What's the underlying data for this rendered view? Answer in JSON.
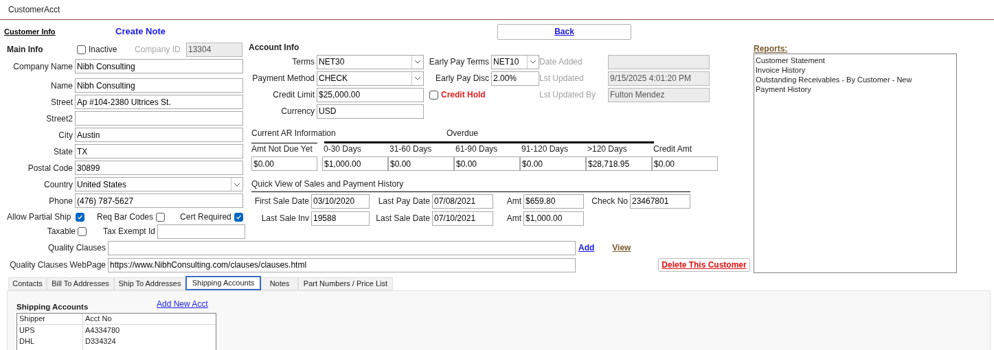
{
  "window": {
    "title": "CustomerAcct"
  },
  "header": {
    "customer_info_link": "Customer Info",
    "create_note_link": "Create Note",
    "back_button": "Back"
  },
  "main_info": {
    "title": "Main Info",
    "inactive": {
      "label": "Inactive",
      "checked": false
    },
    "company_id": {
      "label": "Company ID",
      "value": "13304"
    },
    "fields": [
      {
        "kind": "text",
        "label": "Company Name",
        "value": "Nibh Consulting"
      },
      {
        "kind": "text",
        "label": "Name",
        "value": "Nibh Consulting"
      },
      {
        "kind": "text",
        "label": "Street",
        "value": "Ap #104-2380 Ultrices St."
      },
      {
        "kind": "text",
        "label": "Street2"
      },
      {
        "kind": "text",
        "label": "City",
        "value": "Austin"
      },
      {
        "kind": "text",
        "label": "State",
        "value": "TX"
      },
      {
        "kind": "text",
        "label": "Postal Code",
        "value": "30899"
      },
      {
        "kind": "select",
        "label": "Country",
        "value": "United States"
      },
      {
        "kind": "text",
        "label": "Phone",
        "value": "(476) 787-5627"
      }
    ],
    "flags": [
      {
        "label": "Allow Partial Ship",
        "checked": true
      },
      {
        "label": "Req Bar Codes",
        "checked": false
      },
      {
        "label": "Cert Required",
        "checked": true
      },
      {
        "label": "Taxable",
        "checked": false
      }
    ],
    "tax_exempt_id": {
      "label": "Tax Exempt Id"
    }
  },
  "account_info": {
    "title": "Account Info",
    "terms": {
      "label": "Terms",
      "value": "NET30"
    },
    "payment_method": {
      "label": "Payment Method",
      "value": "CHECK"
    },
    "credit_limit": {
      "label": "Credit Limit",
      "value": "$25,000.00"
    },
    "currency": {
      "label": "Currency",
      "value": "USD"
    },
    "early_pay_terms": {
      "label": "Early Pay Terms",
      "value": "NET10"
    },
    "early_pay_disc": {
      "label": "Early Pay Disc",
      "value": "2.00%"
    },
    "credit_hold": {
      "label": "Credit Hold",
      "checked": false
    },
    "date_added": {
      "label": "Date Added"
    },
    "lst_updated": {
      "label": "Lst Updated",
      "value": "9/15/2025 4:01:20 PM"
    },
    "lst_updated_by": {
      "label": "Lst Updated By",
      "value": "Fulton Mendez"
    }
  },
  "ar": {
    "title": "Current AR Information",
    "overdue_label": "Overdue",
    "columns": [
      {
        "label": "Amt Not Due Yet",
        "value": "$0.00"
      },
      {
        "label": "0-30 Days",
        "value": "$1,000.00"
      },
      {
        "label": "31-60 Days",
        "value": "$0.00"
      },
      {
        "label": "61-90 Days",
        "value": "$0.00"
      },
      {
        "label": "91-120 Days",
        "value": "$0.00"
      },
      {
        "label": ">120 Days",
        "value": "$28,718.95"
      },
      {
        "label": "Credit Amt",
        "value": "$0.00"
      }
    ]
  },
  "quick_view": {
    "title": "Quick View of Sales and Payment History",
    "rows": [
      [
        {
          "label": "First Sale Date",
          "value": "03/10/2020"
        },
        {
          "label": "Last Pay Date",
          "value": "07/08/2021"
        },
        {
          "label": "Amt",
          "value": "$659.80"
        },
        {
          "label": "Check No",
          "value": "23467801"
        }
      ],
      [
        {
          "label": "Last Sale Inv",
          "value": "19588"
        },
        {
          "label": "Last Sale Date",
          "value": "07/10/2021"
        },
        {
          "label": "Amt",
          "value": "$1,000.00"
        }
      ]
    ]
  },
  "quality_clauses": {
    "label": "Quality Clauses",
    "add_link": "Add",
    "view_link": "View"
  },
  "quality_webpage": {
    "label": "Quality Clauses WebPage",
    "value": "https://www.NibhConsulting.com/clauses/clauses.html"
  },
  "delete_button": "Delete This Customer",
  "reports": {
    "title": "Reports:",
    "items": [
      "Customer Statement",
      "Invoice History",
      "Outstanding Receivables - By Customer - New",
      "Payment History"
    ]
  },
  "tabs": [
    {
      "label": "Contacts",
      "selected": false
    },
    {
      "label": "Bill To Addresses",
      "selected": false
    },
    {
      "label": "Ship To Addresses",
      "selected": false
    },
    {
      "label": "Shipping Accounts",
      "selected": true
    },
    {
      "label": "Notes",
      "selected": false
    },
    {
      "label": "Part Numbers / Price List",
      "selected": false
    }
  ],
  "shipping_accounts": {
    "title": "Shipping Accounts",
    "add_link": "Add New Acct",
    "columns": [
      "Shipper",
      "Acct No"
    ],
    "rows": [
      [
        "UPS",
        "A4334780"
      ],
      [
        "DHL",
        "D334324"
      ]
    ]
  }
}
